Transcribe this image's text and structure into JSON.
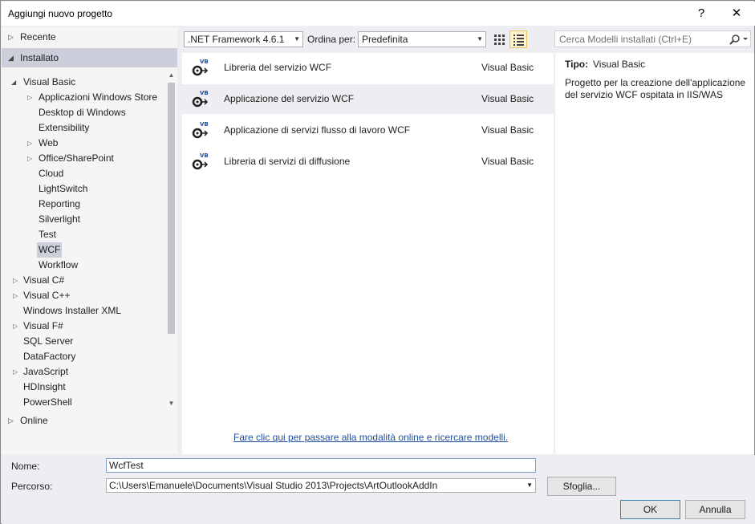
{
  "window": {
    "title": "Aggiungi nuovo progetto",
    "help": "?",
    "close": "✕"
  },
  "left": {
    "recent": "Recente",
    "installed": "Installato",
    "online": "Online",
    "tree": [
      {
        "label": "Visual Basic",
        "arrow": "◢"
      },
      {
        "label": "Applicazioni Windows Store",
        "arrow": "▷"
      },
      {
        "label": "Desktop di Windows",
        "arrow": ""
      },
      {
        "label": "Extensibility",
        "arrow": ""
      },
      {
        "label": "Web",
        "arrow": "▷"
      },
      {
        "label": "Office/SharePoint",
        "arrow": "▷"
      },
      {
        "label": "Cloud",
        "arrow": ""
      },
      {
        "label": "LightSwitch",
        "arrow": ""
      },
      {
        "label": "Reporting",
        "arrow": ""
      },
      {
        "label": "Silverlight",
        "arrow": ""
      },
      {
        "label": "Test",
        "arrow": ""
      },
      {
        "label": "WCF",
        "arrow": ""
      },
      {
        "label": "Workflow",
        "arrow": ""
      },
      {
        "label": "Visual C#",
        "arrow": "▷"
      },
      {
        "label": "Visual C++",
        "arrow": "▷"
      },
      {
        "label": "Windows Installer XML",
        "arrow": ""
      },
      {
        "label": "Visual F#",
        "arrow": "▷"
      },
      {
        "label": "SQL Server",
        "arrow": ""
      },
      {
        "label": "DataFactory",
        "arrow": ""
      },
      {
        "label": "JavaScript",
        "arrow": "▷"
      },
      {
        "label": "HDInsight",
        "arrow": ""
      },
      {
        "label": "PowerShell",
        "arrow": ""
      }
    ]
  },
  "toolbar": {
    "framework": ".NET Framework 4.6.1",
    "sort_label": "Ordina per:",
    "sort_value": "Predefinita",
    "search_placeholder": "Cerca Modelli installati (Ctrl+E)"
  },
  "templates": [
    {
      "name": "Libreria del servizio WCF",
      "lang": "Visual Basic",
      "badge": "VB"
    },
    {
      "name": "Applicazione del servizio WCF",
      "lang": "Visual Basic",
      "badge": "VB"
    },
    {
      "name": "Applicazione di servizi flusso di lavoro WCF",
      "lang": "Visual Basic",
      "badge": "VB"
    },
    {
      "name": "Libreria di servizi di diffusione",
      "lang": "Visual Basic",
      "badge": "VB"
    }
  ],
  "online_link": "Fare clic qui per passare alla modalità online e ricercare modelli.",
  "details": {
    "type_label": "Tipo:",
    "type_value": "Visual Basic",
    "description": "Progetto per la creazione dell'applicazione del servizio WCF ospitata in IIS/WAS"
  },
  "form": {
    "name_label": "Nome:",
    "name_value": "WcfTest",
    "path_label": "Percorso:",
    "path_value": "C:\\Users\\Emanuele\\Documents\\Visual Studio 2013\\Projects\\ArtOutlookAddIn",
    "browse": "Sfoglia...",
    "ok": "OK",
    "cancel": "Annulla"
  },
  "colors": {
    "accent": "#1e4e9c",
    "selection": "#cccedb",
    "panel": "#eeeef2"
  }
}
